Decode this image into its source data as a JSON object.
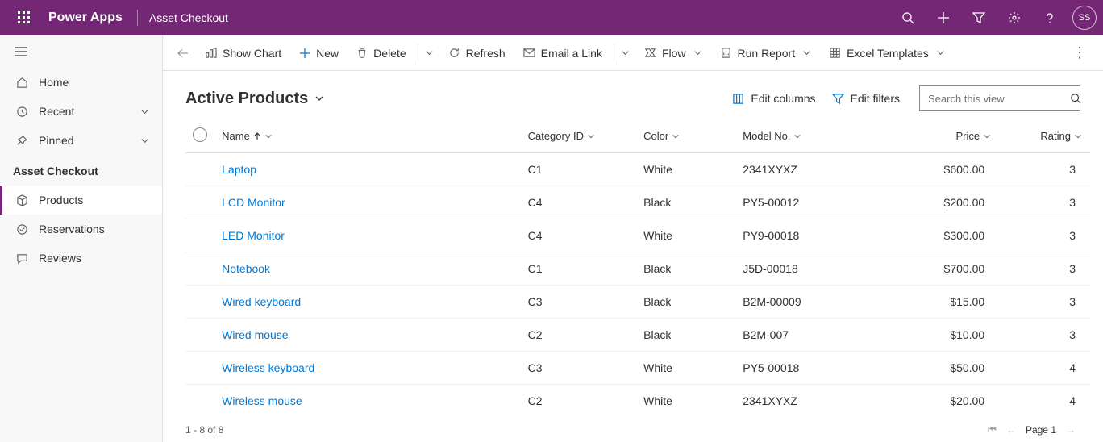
{
  "header": {
    "brand": "Power Apps",
    "context": "Asset Checkout",
    "avatar": "SS"
  },
  "sidebar": {
    "home": "Home",
    "recent": "Recent",
    "pinned": "Pinned",
    "section": "Asset Checkout",
    "items": [
      {
        "label": "Products"
      },
      {
        "label": "Reservations"
      },
      {
        "label": "Reviews"
      }
    ]
  },
  "commands": {
    "showChart": "Show Chart",
    "new": "New",
    "delete": "Delete",
    "refresh": "Refresh",
    "emailLink": "Email a Link",
    "flow": "Flow",
    "runReport": "Run Report",
    "excel": "Excel Templates"
  },
  "view": {
    "title": "Active Products",
    "editColumns": "Edit columns",
    "editFilters": "Edit filters",
    "searchPlaceholder": "Search this view"
  },
  "columns": {
    "name": "Name",
    "category": "Category ID",
    "color": "Color",
    "model": "Model No.",
    "price": "Price",
    "rating": "Rating"
  },
  "rows": [
    {
      "name": "Laptop",
      "category": "C1",
      "color": "White",
      "model": "2341XYXZ",
      "price": "$600.00",
      "rating": "3"
    },
    {
      "name": "LCD Monitor",
      "category": "C4",
      "color": "Black",
      "model": "PY5-00012",
      "price": "$200.00",
      "rating": "3"
    },
    {
      "name": "LED Monitor",
      "category": "C4",
      "color": "White",
      "model": "PY9-00018",
      "price": "$300.00",
      "rating": "3"
    },
    {
      "name": "Notebook",
      "category": "C1",
      "color": "Black",
      "model": "J5D-00018",
      "price": "$700.00",
      "rating": "3"
    },
    {
      "name": "Wired keyboard",
      "category": "C3",
      "color": "Black",
      "model": "B2M-00009",
      "price": "$15.00",
      "rating": "3"
    },
    {
      "name": "Wired mouse",
      "category": "C2",
      "color": "Black",
      "model": "B2M-007",
      "price": "$10.00",
      "rating": "3"
    },
    {
      "name": "Wireless keyboard",
      "category": "C3",
      "color": "White",
      "model": "PY5-00018",
      "price": "$50.00",
      "rating": "4"
    },
    {
      "name": "Wireless mouse",
      "category": "C2",
      "color": "White",
      "model": "2341XYXZ",
      "price": "$20.00",
      "rating": "4"
    }
  ],
  "footer": {
    "summary": "1 - 8 of 8",
    "page": "Page 1"
  }
}
